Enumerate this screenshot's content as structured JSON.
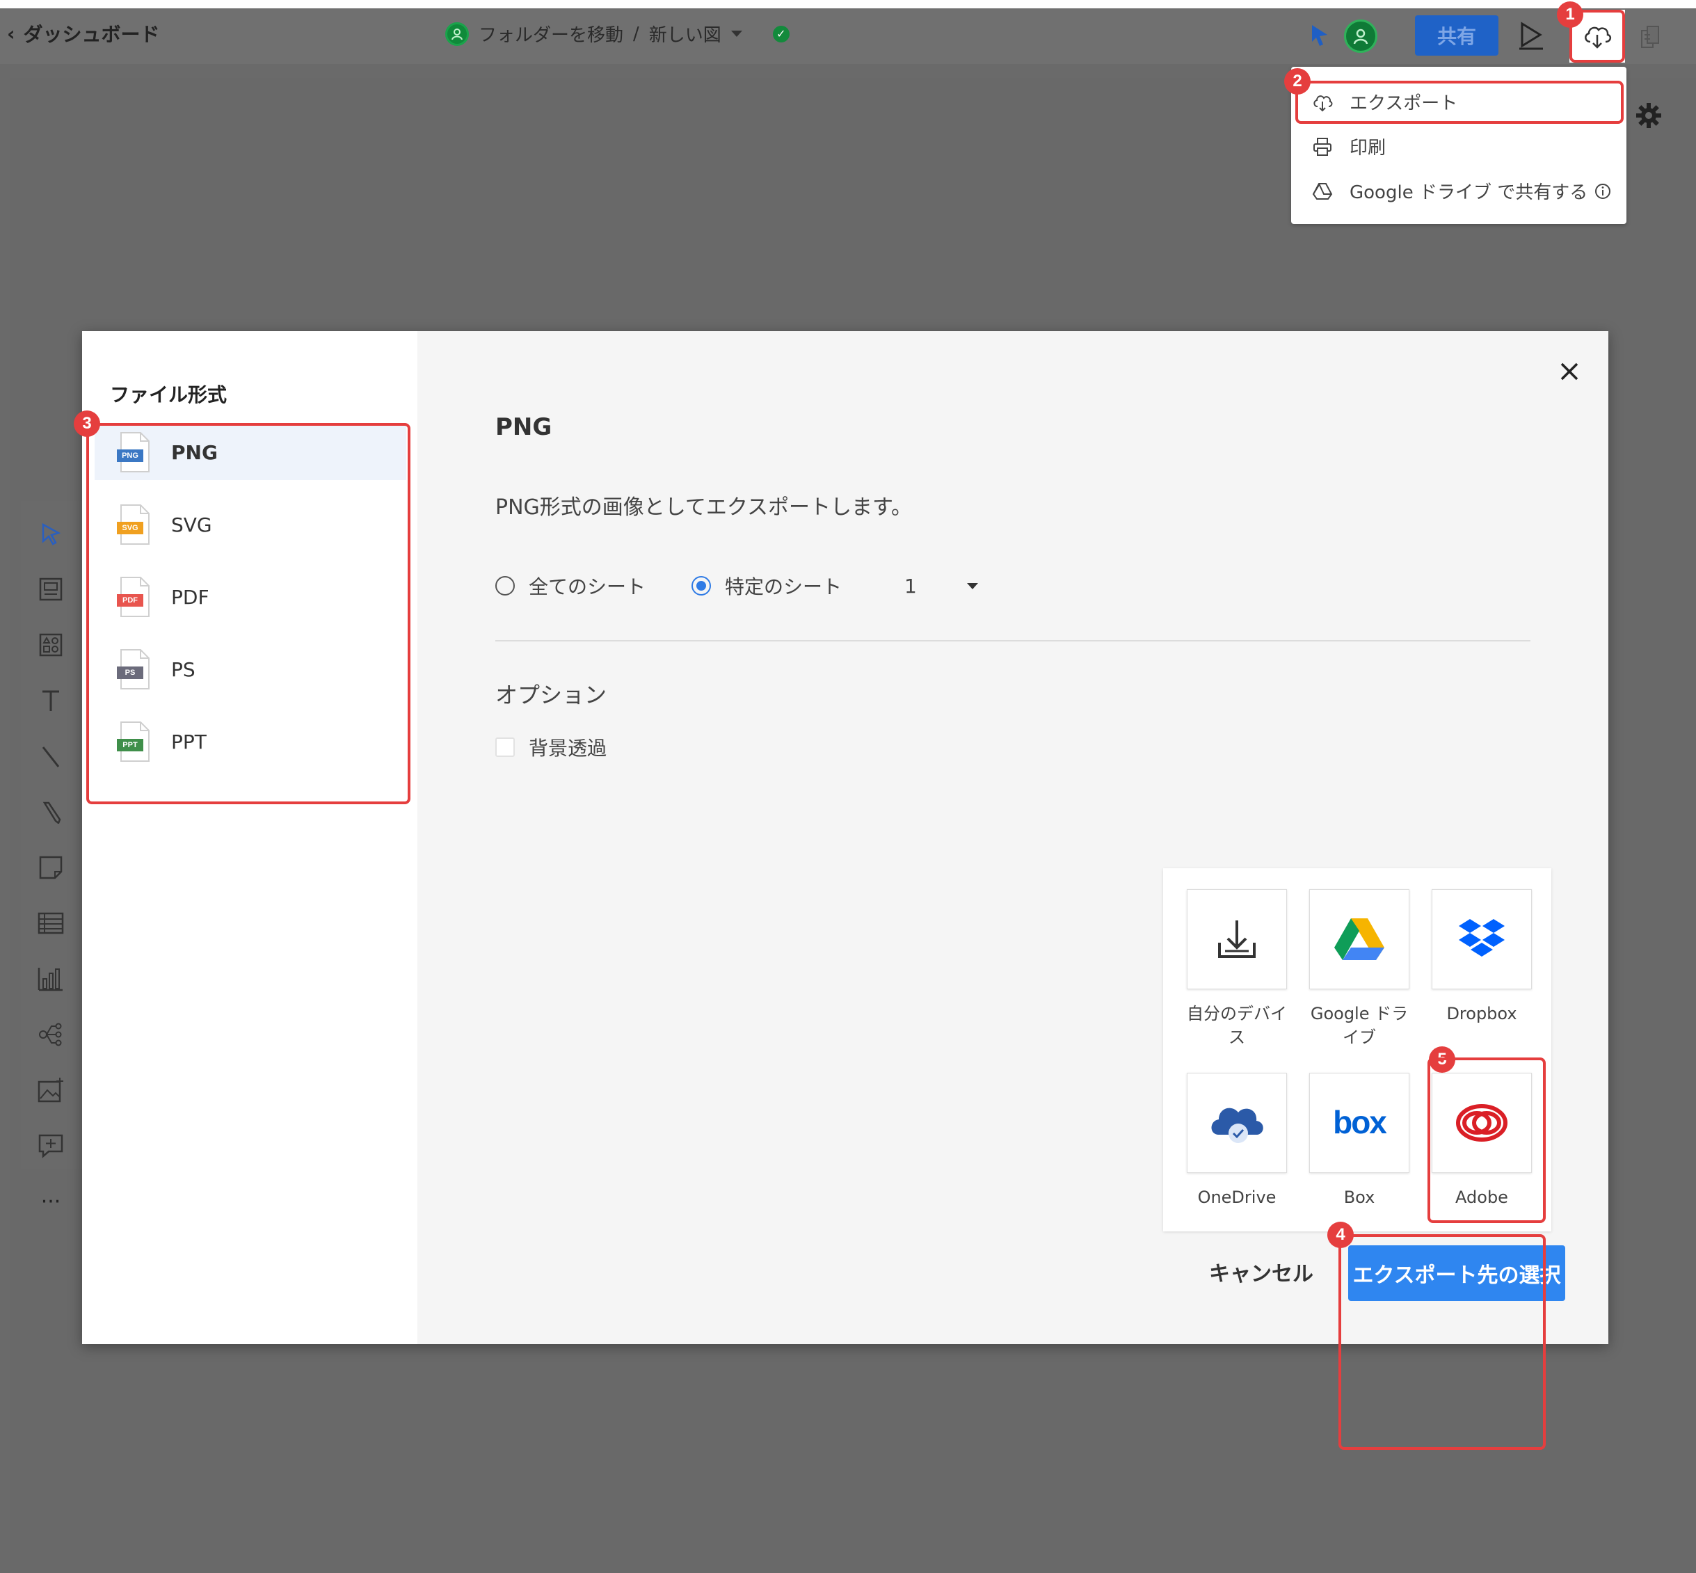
{
  "topbar": {
    "back_label": "ダッシュボード",
    "folder_label": "フォルダーを移動",
    "separator": "/",
    "doc_title": "新しい図",
    "share_label": "共有"
  },
  "export_menu": {
    "items": [
      {
        "label": "エクスポート",
        "icon": "cloud-upload-icon"
      },
      {
        "label": "印刷",
        "icon": "printer-icon"
      },
      {
        "label": "Google ドライブ で共有する",
        "icon": "google-drive-icon"
      }
    ]
  },
  "dialog": {
    "format_title": "ファイル形式",
    "formats": [
      {
        "label": "PNG",
        "tag": "PNG",
        "color": "#3b78c4"
      },
      {
        "label": "SVG",
        "tag": "SVG",
        "color": "#f0a020"
      },
      {
        "label": "PDF",
        "tag": "PDF",
        "color": "#e8554e"
      },
      {
        "label": "PS",
        "tag": "PS",
        "color": "#6b6b7b"
      },
      {
        "label": "PPT",
        "tag": "PPT",
        "color": "#3f8f4a"
      }
    ],
    "selected_title": "PNG",
    "description": "PNG形式の画像としてエクスポートします。",
    "all_sheets_label": "全てのシート",
    "specific_sheet_label": "特定のシート",
    "sheet_value": "1",
    "options_title": "オプション",
    "transparent_label": "背景透過",
    "destinations": [
      {
        "label": "自分のデバイス",
        "icon": "download-icon"
      },
      {
        "label": "Google ドライブ",
        "icon": "google-drive-icon"
      },
      {
        "label": "Dropbox",
        "icon": "dropbox-icon"
      },
      {
        "label": "OneDrive",
        "icon": "onedrive-icon"
      },
      {
        "label": "Box",
        "icon": "box-icon"
      },
      {
        "label": "Adobe",
        "icon": "adobe-icon"
      }
    ],
    "cancel_label": "キャンセル",
    "export_label": "エクスポート先の選択"
  },
  "badges": [
    "1",
    "2",
    "3",
    "4",
    "5"
  ],
  "colors": {
    "accent": "#2f86f0",
    "annotation": "#e53e3e",
    "share": "#1f62c7"
  }
}
